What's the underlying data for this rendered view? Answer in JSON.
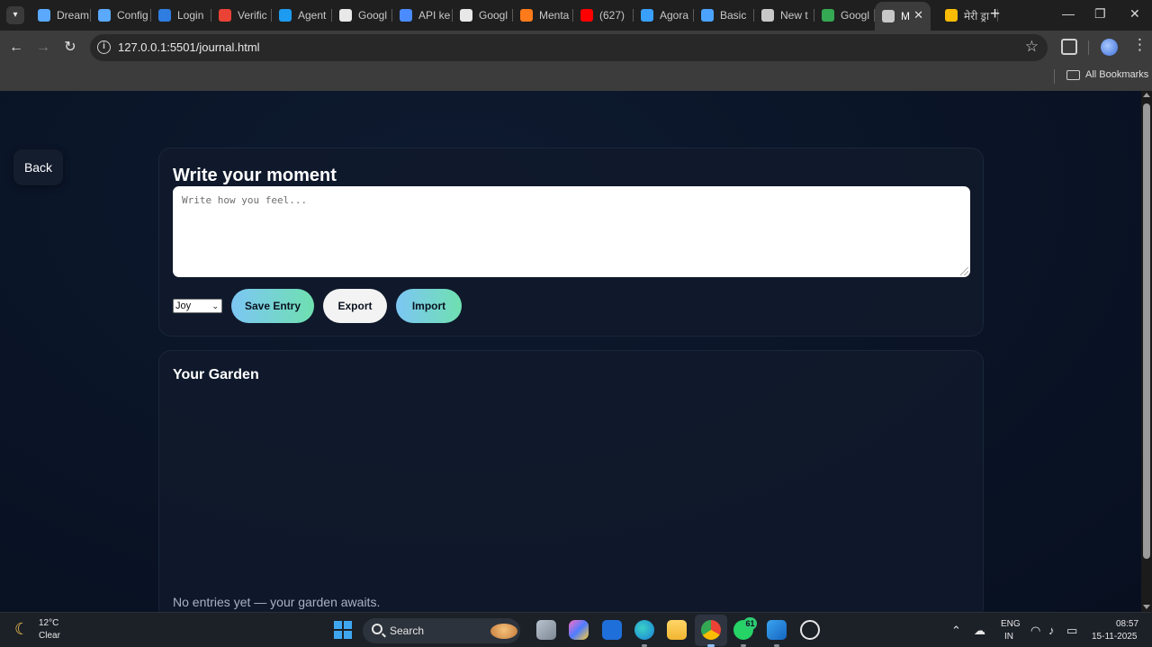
{
  "browser": {
    "tabs": [
      {
        "title": "Dream",
        "icon": "arch-icon",
        "color": "#5aa9ff"
      },
      {
        "title": "Config",
        "icon": "arch-icon",
        "color": "#5aa9ff"
      },
      {
        "title": "Login",
        "icon": "cloud-icon",
        "color": "#2f7de1"
      },
      {
        "title": "Verific",
        "icon": "gmail-icon",
        "color": "#ea4335"
      },
      {
        "title": "Agent",
        "icon": "cloud-icon",
        "color": "#1d9bf0"
      },
      {
        "title": "Googl",
        "icon": "studio-icon",
        "color": "#e8e8e8"
      },
      {
        "title": "API ke",
        "icon": "openai-icon",
        "color": "#4a8cff"
      },
      {
        "title": "Googl",
        "icon": "studio-icon",
        "color": "#e8e8e8"
      },
      {
        "title": "Menta",
        "icon": "flame-icon",
        "color": "#ff7a1a"
      },
      {
        "title": "(627)",
        "icon": "youtube-icon",
        "color": "#ff0000"
      },
      {
        "title": "Agora",
        "icon": "agora-icon",
        "color": "#39a0ff"
      },
      {
        "title": "Basic",
        "icon": "search-tab-icon",
        "color": "#4ba3ff"
      },
      {
        "title": "New t",
        "icon": "chrome-icon",
        "color": "#c8c8c8"
      },
      {
        "title": "Googl",
        "icon": "drive-icon",
        "color": "#34a853"
      },
      {
        "title": "M",
        "icon": "globe-icon",
        "color": "#c8c8c8",
        "active": true
      },
      {
        "title": "मेरी ड्रा",
        "icon": "drive-icon",
        "color": "#fbbc04"
      }
    ],
    "tab_close": "✕",
    "new_tab": "+",
    "window_controls": {
      "minimize": "—",
      "maximize": "❐",
      "close": "✕"
    },
    "back_glyph": "←",
    "forward_glyph": "→",
    "reload_glyph": "↻",
    "url": "127.0.0.1:5501/journal.html",
    "star_glyph": "☆",
    "menu_glyph": "⋮",
    "bookmarks_label": "All Bookmarks"
  },
  "page": {
    "back_label": "Back",
    "write_title": "Write your moment",
    "entry_placeholder": "Write how you feel...",
    "mood_selected": "Joy",
    "save_label": "Save Entry",
    "export_label": "Export",
    "import_label": "Import",
    "garden_title": "Your Garden",
    "empty_message": "No entries yet — your garden awaits."
  },
  "taskbar": {
    "weather_temp": "12°C",
    "weather_desc": "Clear",
    "search_label": "Search",
    "whatsapp_badge": "61",
    "lang_top": "ENG",
    "lang_bottom": "IN",
    "time": "08:57",
    "date": "15-11-2025"
  },
  "colors": {
    "page_bg": "#0b1220",
    "accent_start": "#7cc6f4",
    "accent_end": "#6fe0b0"
  }
}
